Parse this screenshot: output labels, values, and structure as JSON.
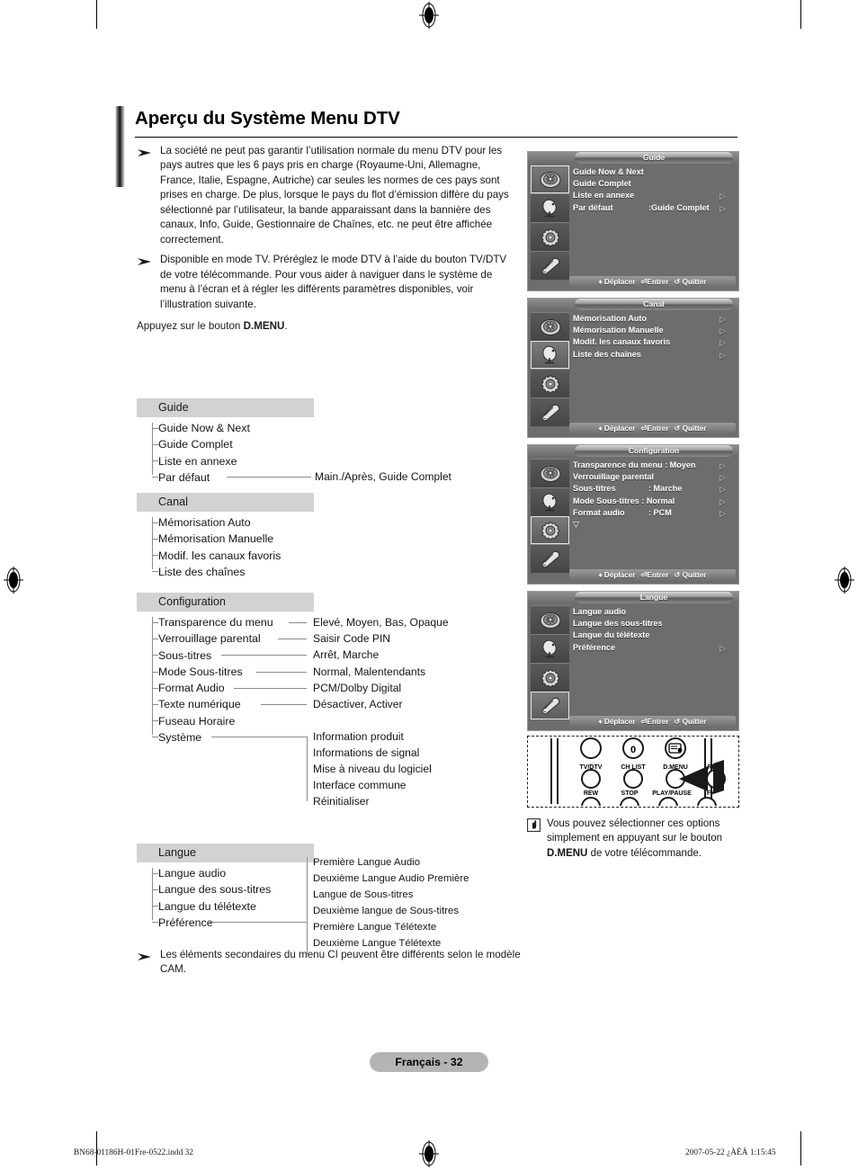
{
  "document": {
    "title": "Aperçu du Système Menu DTV",
    "page_badge": "Français - 32",
    "footer_left": "BN68-01186H-01Fre-0522.indd   32",
    "footer_right": "2007-05-22   ¿ÀÈÄ 1:15:45"
  },
  "intro": {
    "bullet1": "La société ne peut pas garantir l’utilisation normale du menu DTV pour les pays autres que les 6 pays pris en charge (Royaume-Uni, Allemagne, France, Italie, Espagne, Autriche) car seules les normes de ces pays sont prises en charge. De plus, lorsque le pays du flot d’émission diffère du pays sélectionné par l’utilisateur, la bande apparaissant dans la bannière des canaux, Info, Guide, Gestionnaire de Chaînes, etc. ne peut être affichée correctement.",
    "bullet2": "Disponible en mode TV. Préréglez le mode DTV à l’aide du bouton TV/DTV de votre télécommande. Pour vous aider à naviguer dans le système de menu à l’écran et à régler les différents paramètres disponibles, voir l’illustration suivante.",
    "press_prefix": "Appuyez sur le bouton ",
    "press_bold": "D.MENU",
    "press_suffix": "."
  },
  "tree": {
    "guide": {
      "heading": "Guide",
      "items": [
        "Guide Now & Next",
        "Guide Complet",
        "Liste en annexe",
        "Par défaut"
      ],
      "values": [
        "Main./Après, Guide Complet"
      ]
    },
    "canal": {
      "heading": "Canal",
      "items": [
        "Mémorisation Auto",
        "Mémorisation Manuelle",
        "Modif. les canaux favoris",
        "Liste des chaînes"
      ]
    },
    "configuration": {
      "heading": "Configuration",
      "items": [
        "Transparence du menu",
        "Verrouillage parental",
        "Sous-titres",
        "Mode Sous-titres",
        "Format Audio",
        "Texte numérique",
        "Fuseau Horaire",
        "Système"
      ],
      "values": [
        "Elevé, Moyen, Bas, Opaque",
        "Saisir Code PIN",
        "Arrêt, Marche",
        "Normal, Malentendants",
        "PCM/Dolby Digital",
        "Désactiver, Activer"
      ],
      "system_values": [
        "Information produit",
        "Informations de signal",
        "Mise à niveau du logiciel",
        "Interface commune",
        "Réinitialiser"
      ]
    },
    "langue": {
      "heading": "Langue",
      "items": [
        "Langue audio",
        "Langue des sous-titres",
        "Langue du télétexte",
        "Préférence"
      ],
      "preference_values": [
        "Première Langue Audio",
        "Deuxième Langue Audio Première",
        "Langue de Sous-titres",
        "Deuxième langue de Sous-titres",
        "Première Langue Télétexte",
        "Deuxième Langue Télétexte"
      ]
    }
  },
  "footnote": {
    "text": "Les éléments secondaires du menu CI peuvent être différents selon le modèle CAM."
  },
  "osd": {
    "statusbar": {
      "move": "Déplacer",
      "enter": "Entrer",
      "exit": "Quitter"
    },
    "panels": [
      {
        "title": "Guide",
        "selected_icon": 0,
        "rows": [
          {
            "label": "Guide Now & Next",
            "value": "",
            "arrow": false
          },
          {
            "label": "Guide Complet",
            "value": "",
            "arrow": false
          },
          {
            "label": "Liste en annexe",
            "value": "",
            "arrow": true
          },
          {
            "label": "Par défaut",
            "value": ":Guide Complet",
            "arrow": true
          }
        ],
        "more": false
      },
      {
        "title": "Canal",
        "selected_icon": 1,
        "rows": [
          {
            "label": "Mémorisation Auto",
            "value": "",
            "arrow": true
          },
          {
            "label": "Mémorisation Manuelle",
            "value": "",
            "arrow": true
          },
          {
            "label": "Modif. les canaux favoris",
            "value": "",
            "arrow": true
          },
          {
            "label": "Liste des chaînes",
            "value": "",
            "arrow": true
          }
        ],
        "more": false
      },
      {
        "title": "Configuration",
        "selected_icon": 2,
        "rows": [
          {
            "label": "Transparence du menu : Moyen",
            "value": "",
            "arrow": true
          },
          {
            "label": "Verrouillage parental",
            "value": "",
            "arrow": true
          },
          {
            "label": "Sous-titres",
            "value": ": Marche",
            "arrow": true
          },
          {
            "label": "Mode Sous-titres : Normal",
            "value": "",
            "arrow": true
          },
          {
            "label": "Format audio",
            "value": ": PCM",
            "arrow": true
          }
        ],
        "more": true
      },
      {
        "title": "Langue",
        "selected_icon": 3,
        "rows": [
          {
            "label": "Langue audio",
            "value": "",
            "arrow": false
          },
          {
            "label": "Langue des sous-titres",
            "value": "",
            "arrow": false
          },
          {
            "label": "Langue du télétexte",
            "value": "",
            "arrow": false
          },
          {
            "label": "Préférence",
            "value": "",
            "arrow": true
          }
        ],
        "more": false
      }
    ],
    "icon_names": [
      "guide-icon",
      "satellite-dish-icon",
      "gear-icon",
      "speech-icon"
    ]
  },
  "remote": {
    "top_labels": [
      "TV/DTV",
      "CH LIST",
      "D.MENU",
      "REC"
    ],
    "bottom_labels": [
      "REW",
      "STOP",
      "PLAY/PAUSE",
      "F+"
    ],
    "zero_key": "0"
  },
  "note": {
    "prefix": "Vous pouvez sélectionner ces options simplement en appuyant sur le bouton ",
    "bold": "D.MENU",
    "suffix": " de votre télécommande."
  }
}
